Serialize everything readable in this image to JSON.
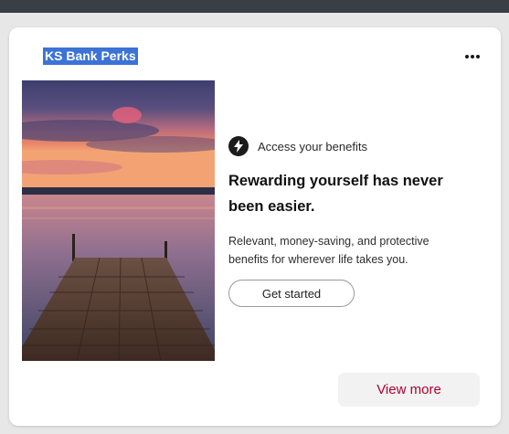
{
  "card": {
    "title": "KS Bank Perks",
    "more_menu_icon": "more-horizontal-icon"
  },
  "hero": {
    "image_subject": "dock-at-sunset-photo"
  },
  "content": {
    "eyebrow_icon": "lightning-bolt-icon",
    "eyebrow": "Access your benefits",
    "headline": "Rewarding yourself has never been easier.",
    "description": "Relevant, money-saving, and protective benefits for wherever life takes you.",
    "cta_label": "Get started"
  },
  "footer": {
    "view_more_label": "View more"
  },
  "colors": {
    "title_highlight": "#3b73d6",
    "view_more_text": "#b1002b",
    "topbar": "#3a3f46"
  }
}
